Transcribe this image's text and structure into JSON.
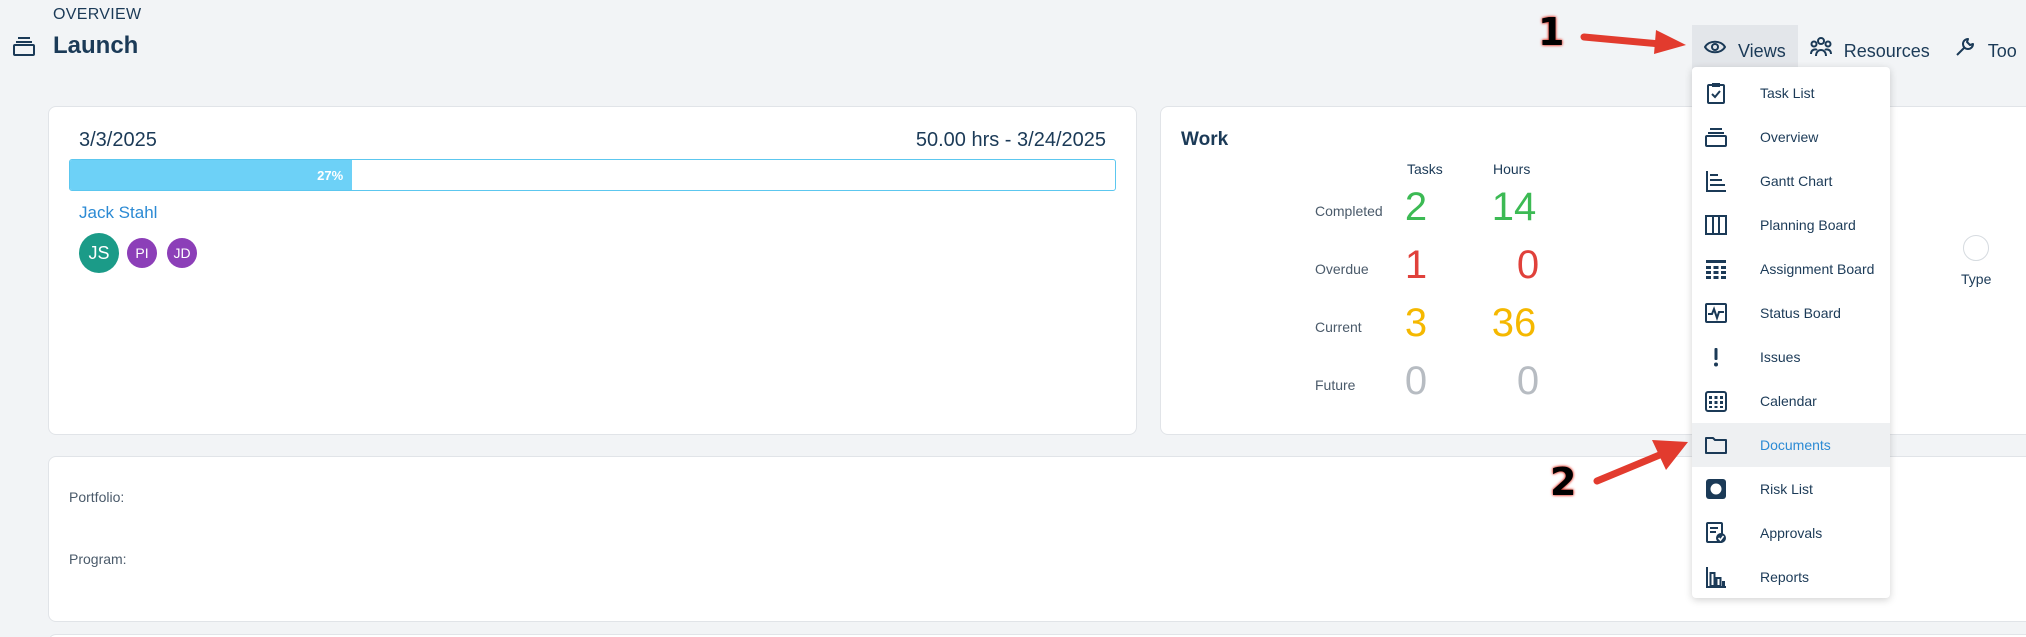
{
  "header": {
    "section": "OVERVIEW",
    "title": "Launch",
    "icon": "overview-stack-icon"
  },
  "topnav": [
    {
      "label": "Views",
      "icon": "eye-icon",
      "active": true
    },
    {
      "label": "Resources",
      "icon": "people-icon",
      "active": false
    },
    {
      "label": "Too",
      "icon": "wrench-icon",
      "active": false
    }
  ],
  "summary": {
    "start_date": "3/3/2025",
    "end_info": "50.00 hrs - 3/24/2025",
    "progress_pct": 27,
    "progress_label": "27%",
    "manager": "Jack Stahl",
    "avatars": [
      "JS",
      "PI",
      "JD"
    ]
  },
  "work": {
    "title": "Work",
    "col_tasks": "Tasks",
    "col_hours": "Hours",
    "rows": [
      {
        "label": "Completed",
        "tasks": "2",
        "hours": "14",
        "color": "#3cba54"
      },
      {
        "label": "Overdue",
        "tasks": "1",
        "hours": "0",
        "color": "#e0413b"
      },
      {
        "label": "Current",
        "tasks": "3",
        "hours": "36",
        "color": "#f5b800"
      },
      {
        "label": "Future",
        "tasks": "0",
        "hours": "0",
        "color": "#b7bcc2"
      }
    ],
    "type_label": "Type"
  },
  "details": {
    "portfolio_label": "Portfolio:",
    "program_label": "Program:"
  },
  "views_menu": [
    {
      "label": "Task List",
      "icon": "checkbox-clipboard-icon"
    },
    {
      "label": "Overview",
      "icon": "overview-stack-icon"
    },
    {
      "label": "Gantt Chart",
      "icon": "gantt-icon"
    },
    {
      "label": "Planning Board",
      "icon": "columns-icon"
    },
    {
      "label": "Assignment Board",
      "icon": "grid-icon"
    },
    {
      "label": "Status Board",
      "icon": "pulse-icon"
    },
    {
      "label": "Issues",
      "icon": "exclamation-icon"
    },
    {
      "label": "Calendar",
      "icon": "calendar-icon"
    },
    {
      "label": "Documents",
      "icon": "folder-icon",
      "highlighted": true
    },
    {
      "label": "Risk List",
      "icon": "risk-icon"
    },
    {
      "label": "Approvals",
      "icon": "approval-icon"
    },
    {
      "label": "Reports",
      "icon": "bar-chart-icon"
    }
  ],
  "annotations": [
    "1",
    "2"
  ],
  "colors": {
    "primary_text": "#1b3a57",
    "accent_blue": "#2b8ad4",
    "progress_fill": "#6dd1f7",
    "annotation_arrow": "#e23b2e"
  }
}
